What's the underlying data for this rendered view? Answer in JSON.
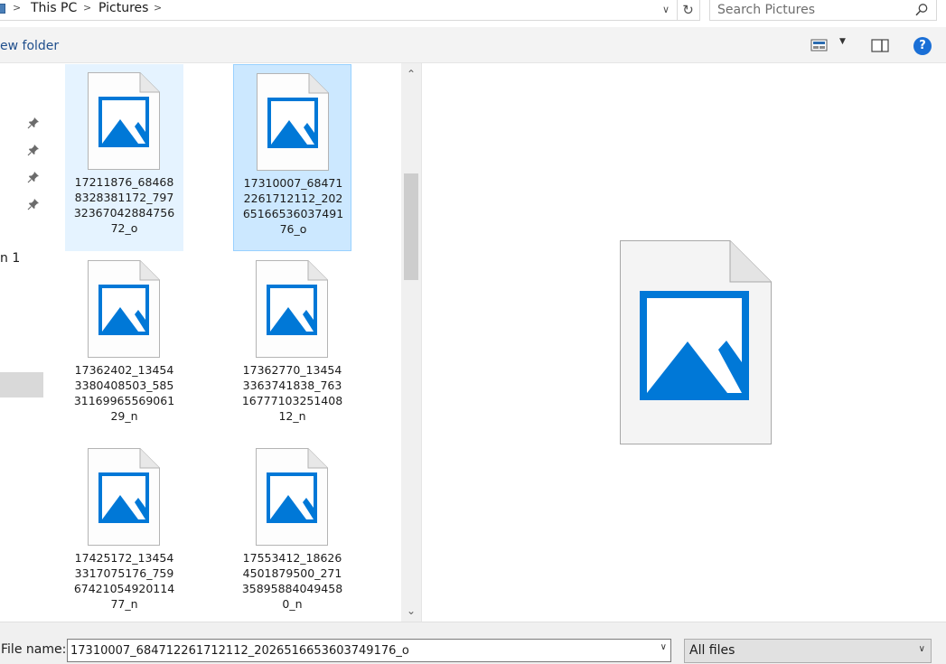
{
  "breadcrumb": [
    "This PC",
    "Pictures"
  ],
  "search": {
    "placeholder": "Search Pictures"
  },
  "toolbar": {
    "new_folder_label": "ew folder",
    "help_label": "?"
  },
  "nav": {
    "partial_label": "n 1"
  },
  "files": [
    {
      "name": "17211876_684688328381172_79732367042884756 72_o",
      "lines": "17211876_68468\n8328381172_797\n32367042884756\n72_o",
      "state": "hover"
    },
    {
      "name": "17310007_684712261712112_2026516653603749176_o",
      "lines": "17310007_68471\n2261712112_202\n65166536037491\n76_o",
      "state": "selected"
    },
    {
      "name": "17362402_134543380408503_5853116996556906129_n",
      "lines": "17362402_13454\n3380408503_585\n31169965569061\n29_n",
      "state": "normal"
    },
    {
      "name": "17362770_134543363741838_7631677710325140812_n",
      "lines": "17362770_13454\n3363741838_763\n16777103251408\n12_n",
      "state": "normal"
    },
    {
      "name": "17425172_134543317075176_7596742105492011477_n",
      "lines": "17425172_13454\n3317075176_759\n67421054920114\n77_n",
      "state": "normal"
    },
    {
      "name": "17553412_186264501879500_2713589588404945 80_n",
      "lines": "17553412_18626\n4501879500_271\n35895884049458\n0_n",
      "state": "normal"
    }
  ],
  "bottom": {
    "file_name_label": "File name:",
    "file_name_value": "17310007_684712261712112_2026516653603749176_o",
    "filter_value": "All files"
  },
  "colors": {
    "accent": "#0078d7",
    "selected_bg": "#cce8ff",
    "hover_bg": "#e5f3ff"
  }
}
